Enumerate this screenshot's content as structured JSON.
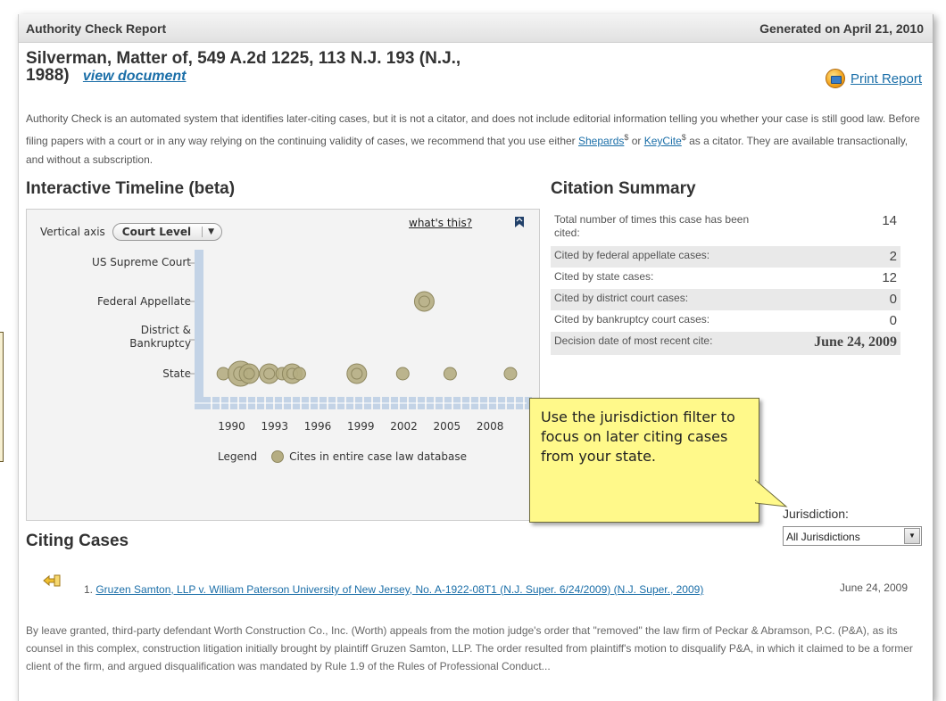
{
  "header": {
    "title": "Authority Check Report",
    "generated": "Generated on April 21, 2010"
  },
  "case": {
    "title_line1": "Silverman, Matter of, 549 A.2d 1225, 113 N.J. 193 (N.J.,",
    "title_line2": "1988)",
    "view_link": "view document"
  },
  "print": {
    "label": "Print Report",
    "icon": "print-report-icon"
  },
  "intro": {
    "part1": "Authority Check is an automated system that identifies later-citing cases, but it is not a citator, and does not include editorial information telling you whether your case is still good law. Before filing papers with a court or in any way relying on the continuing validity of cases, we recommend that you use either ",
    "shepards": "Shepards",
    "sup": "$",
    "or": " or ",
    "keycite": "KeyCite",
    "part2": " as a citator. They are available transactionally, and without a subscription."
  },
  "timeline": {
    "heading": "Interactive Timeline (beta)",
    "vertical_axis_label": "Vertical axis",
    "axis_select_value": "Court Level",
    "whats_this": "what's this?",
    "legend_label": "Legend",
    "legend_item": "Cites in entire case law database"
  },
  "summary": {
    "heading": "Citation Summary",
    "rows": [
      {
        "label": "Total number of times this case has been cited:",
        "value": "14"
      },
      {
        "label": "Cited by federal appellate cases:",
        "value": "2"
      },
      {
        "label": "Cited by state cases:",
        "value": "12"
      },
      {
        "label": "Cited by district court cases:",
        "value": "0"
      },
      {
        "label": "Cited by bankruptcy court cases:",
        "value": "0"
      },
      {
        "label": "Decision date of most recent cite:",
        "value": "June 24, 2009"
      }
    ]
  },
  "callout": {
    "text": "Use the jurisdiction filter to focus on later citing cases from your state."
  },
  "jurisdiction": {
    "label": "Jurisdiction:",
    "value": "All Jurisdictions"
  },
  "citing": {
    "heading": "Citing Cases",
    "items": [
      {
        "number": "1. ",
        "link": "Gruzen Samton, LLP v. William Paterson University of New Jersey, No. A-1922-08T1 (N.J. Super. 6/24/2009) (N.J. Super., 2009)",
        "date": "June 24, 2009",
        "text": "By leave granted, third-party defendant Worth Construction Co., Inc. (Worth) appeals from the motion judge's order that \"removed\" the law firm of Peckar & Abramson, P.C. (P&A), as its counsel in this complex, construction litigation initially brought by plaintiff Gruzen Samton, LLP. The order resulted from plaintiff's motion to disqualify P&A, in which it claimed to be a former client of the firm, and argued disqualification was mandated by Rule 1.9 of the Rules of Professional Conduct..."
      }
    ]
  },
  "chart_data": {
    "type": "scatter",
    "x_ticks": [
      "1990",
      "1993",
      "1996",
      "1999",
      "2002",
      "2005",
      "2008"
    ],
    "y_categories": [
      "US Supreme Court",
      "Federal Appellate",
      "District & Bankruptcy",
      "State"
    ],
    "xlim": [
      1987.5,
      2010
    ],
    "series": [
      {
        "name": "Cites in entire case law database",
        "color": "#b5ad82",
        "points": [
          {
            "x": 1989.5,
            "y": "State",
            "size": 1
          },
          {
            "x": 1990.7,
            "y": "State",
            "size": 3
          },
          {
            "x": 1991.3,
            "y": "State",
            "size": 2
          },
          {
            "x": 1992.7,
            "y": "State",
            "size": 2
          },
          {
            "x": 1993.6,
            "y": "State",
            "size": 1
          },
          {
            "x": 1994.3,
            "y": "State",
            "size": 2
          },
          {
            "x": 1994.8,
            "y": "State",
            "size": 1
          },
          {
            "x": 1998.8,
            "y": "State",
            "size": 2
          },
          {
            "x": 2002.0,
            "y": "State",
            "size": 1
          },
          {
            "x": 2003.5,
            "y": "Federal Appellate",
            "size": 2
          },
          {
            "x": 2005.3,
            "y": "State",
            "size": 1
          },
          {
            "x": 2009.5,
            "y": "State",
            "size": 1
          }
        ]
      }
    ]
  }
}
